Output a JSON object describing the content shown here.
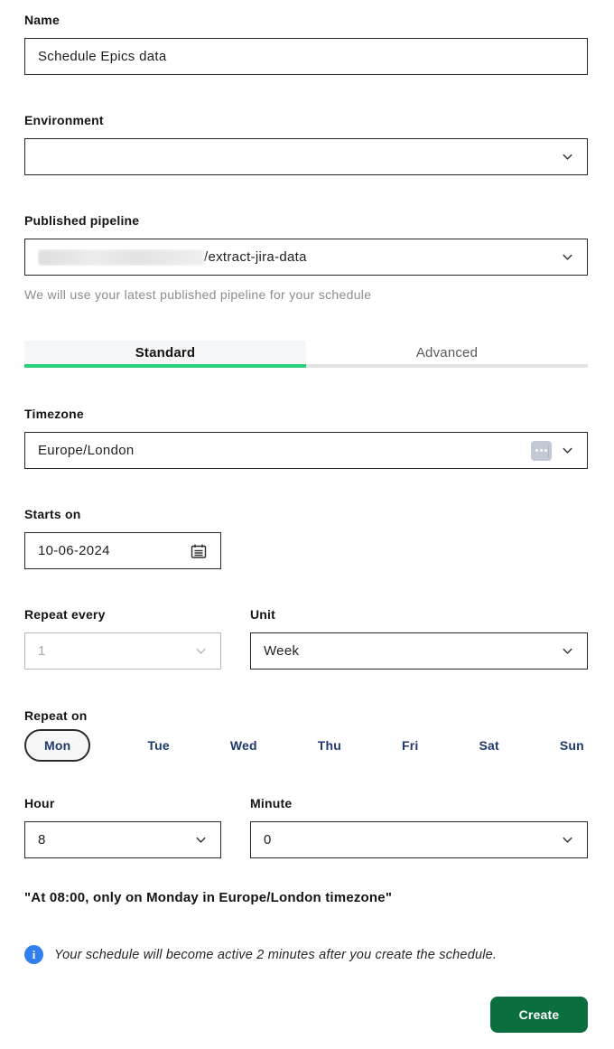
{
  "form": {
    "name": {
      "label": "Name",
      "value": "Schedule Epics data"
    },
    "environment": {
      "label": "Environment",
      "value_redacted": true
    },
    "published_pipeline": {
      "label": "Published pipeline",
      "value_prefix_redacted": true,
      "value_suffix": "/extract-jira-data",
      "helper": "We will use your latest published pipeline for your schedule"
    },
    "tabs": [
      {
        "label": "Standard",
        "active": true
      },
      {
        "label": "Advanced",
        "active": false
      }
    ],
    "timezone": {
      "label": "Timezone",
      "value": "Europe/London"
    },
    "starts_on": {
      "label": "Starts on",
      "value": "10-06-2024"
    },
    "repeat_every": {
      "label": "Repeat every",
      "value": "1",
      "disabled": true
    },
    "unit": {
      "label": "Unit",
      "value": "Week"
    },
    "repeat_on": {
      "label": "Repeat on",
      "days": [
        "Mon",
        "Tue",
        "Wed",
        "Thu",
        "Fri",
        "Sat",
        "Sun"
      ],
      "selected_day": "Mon"
    },
    "hour": {
      "label": "Hour",
      "value": "8"
    },
    "minute": {
      "label": "Minute",
      "value": "0"
    },
    "summary": "\"At 08:00, only on Monday in Europe/London timezone\"",
    "info_note": "Your schedule will become active 2 minutes after you create the schedule.",
    "create_label": "Create"
  },
  "colors": {
    "accent_green": "#29d07e",
    "button_green": "#0a6e3e",
    "info_blue": "#2f80ed",
    "day_navy": "#1e3a6d",
    "border_dark": "#262626",
    "helper_gray": "#8c8c8c"
  },
  "icons": {
    "chevron_down": "chevron-down-icon",
    "calendar": "calendar-icon",
    "timezone_tag": "ellipsis-tag-icon",
    "info": "info-icon"
  }
}
